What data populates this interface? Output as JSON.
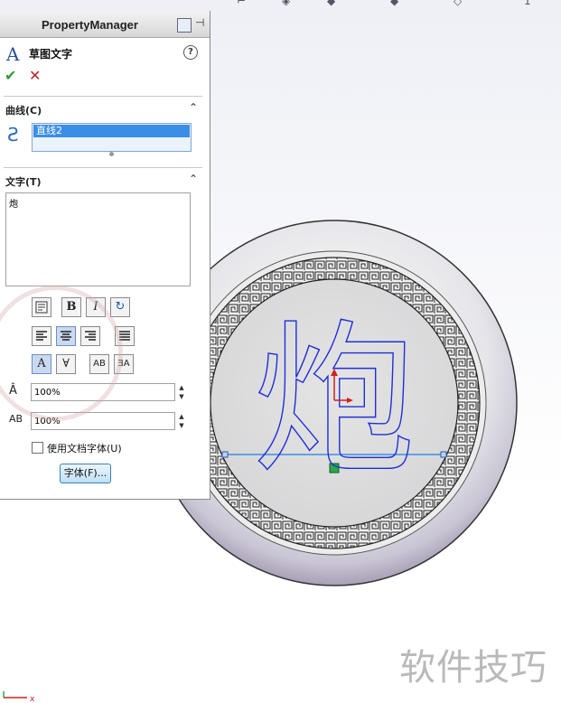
{
  "top_toolbar": {
    "fragment_text": "1"
  },
  "property_manager": {
    "title": "PropertyManager",
    "feature_title": "草图文字",
    "help_label": "?",
    "ok_label": "✔",
    "cancel_label": "✕",
    "curves_group": {
      "title": "曲线(C)",
      "selected_item": "直线2"
    },
    "text_group": {
      "title": "文字(T)",
      "text_value": "炮"
    },
    "format_buttons": [
      "B",
      "I"
    ],
    "width_factor": "100%",
    "spacing": "100%",
    "use_document_font_label": "使用文档字体(U)",
    "use_document_font_checked": false,
    "font_button_label": "字体(F)..."
  },
  "graphics": {
    "sketch_text": "炮",
    "sketch_color": "#1f2fd6",
    "line_color": "#3a8ee6"
  },
  "watermark": {
    "text": "软件技巧"
  },
  "colors": {
    "accent": "#3a8ee6",
    "ok": "#2f9a2f",
    "cancel": "#c0202a"
  }
}
